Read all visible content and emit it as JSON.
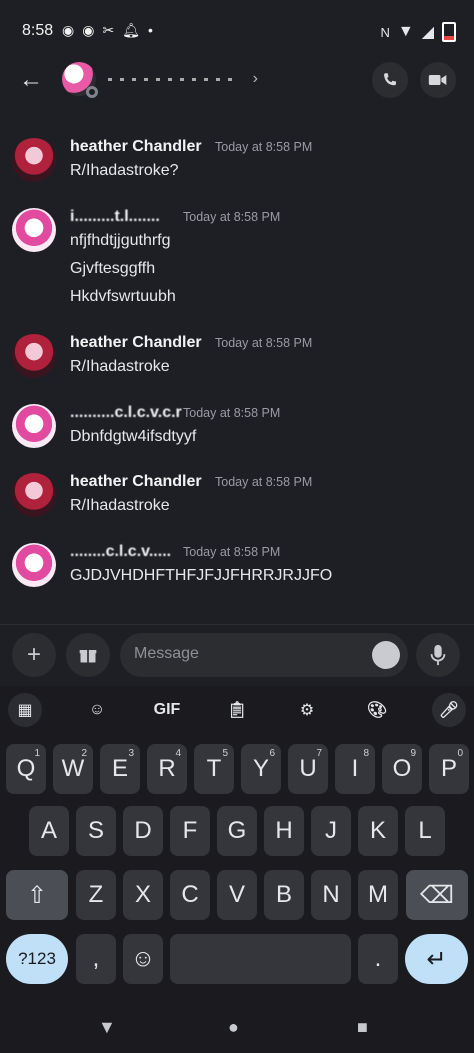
{
  "status_bar": {
    "time": "8:58"
  },
  "header": {
    "back_icon": "back-arrow-icon",
    "chevron": "›"
  },
  "messages": [
    {
      "name": "heather Chandler",
      "time": "Today at 8:58 PM",
      "lines": [
        "R/Ihadastroke?"
      ]
    },
    {
      "name": "i.........t.l.......",
      "time": "Today at 8:58 PM",
      "lines": [
        "nfjfhdtjjguthrfg",
        "Gjvftesggffh",
        "Hkdvfswrtuubh"
      ]
    },
    {
      "name": "heather Chandler",
      "time": "Today at 8:58 PM",
      "lines": [
        "R/Ihadastroke"
      ]
    },
    {
      "name": "..........c.l.c.v.c.r",
      "time": "Today at 8:58 PM",
      "lines": [
        "Dbnfdgtw4ifsdtyyf"
      ]
    },
    {
      "name": "heather Chandler",
      "time": "Today at 8:58 PM",
      "lines": [
        "R/Ihadastroke"
      ]
    },
    {
      "name": "........c.l.c.v.....",
      "time": "Today at 8:58 PM",
      "lines": [
        "GJDJVHDHFTHFJFJJFHRRJRJJFO"
      ]
    }
  ],
  "composer": {
    "placeholder": "Message"
  },
  "keyboard": {
    "toolbar_gif": "GIF",
    "row1": [
      "Q",
      "W",
      "E",
      "R",
      "T",
      "Y",
      "U",
      "I",
      "O",
      "P"
    ],
    "row1_sup": [
      "1",
      "2",
      "3",
      "4",
      "5",
      "6",
      "7",
      "8",
      "9",
      "0"
    ],
    "row2": [
      "A",
      "S",
      "D",
      "F",
      "G",
      "H",
      "J",
      "K",
      "L"
    ],
    "row3": [
      "Z",
      "X",
      "C",
      "V",
      "B",
      "N",
      "M"
    ],
    "num_label": "?123",
    "comma": ",",
    "period": "."
  }
}
